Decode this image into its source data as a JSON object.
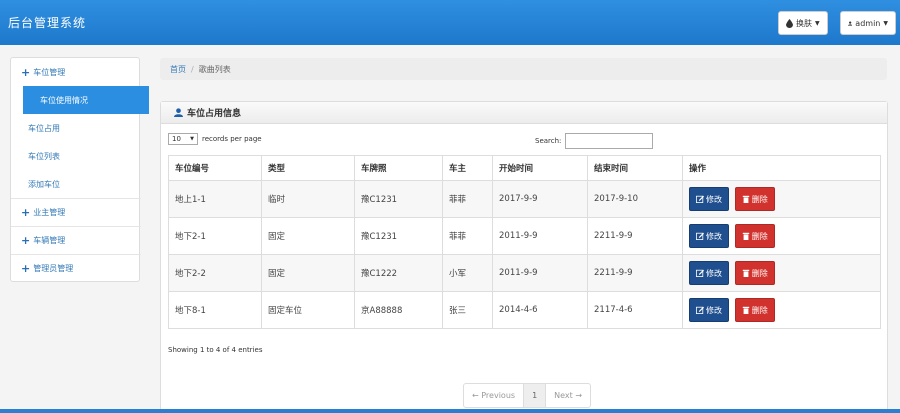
{
  "header": {
    "brand": "后台管理系统",
    "skin_button": "换肤",
    "user_button": "admin"
  },
  "sidebar": {
    "groups": [
      {
        "label": "车位管理",
        "items": [
          "车位使用情况",
          "车位占用",
          "车位列表",
          "添加车位"
        ]
      },
      {
        "label": "业主管理"
      },
      {
        "label": "车辆管理"
      },
      {
        "label": "管理员管理"
      }
    ]
  },
  "breadcrumb": {
    "home": "首页",
    "separator": "/",
    "current": "歌曲列表"
  },
  "panel": {
    "title": "车位占用信息",
    "length_value": "10",
    "length_label": "records per page",
    "search_label": "Search:",
    "search_value": "",
    "columns": [
      "车位编号",
      "类型",
      "车牌照",
      "车主",
      "开始时间",
      "结束时间",
      "操作"
    ],
    "rows": [
      [
        "地上1-1",
        "临时",
        "豫C1231",
        "菲菲",
        "2017-9-9",
        "2017-9-10"
      ],
      [
        "地下2-1",
        "固定",
        "豫C1231",
        "菲菲",
        "2011-9-9",
        "2211-9-9"
      ],
      [
        "地下2-2",
        "固定",
        "豫C1222",
        "小军",
        "2011-9-9",
        "2211-9-9"
      ],
      [
        "地下8-1",
        "固定车位",
        "京A88888",
        "张三",
        "2014-4-6",
        "2117-4-6"
      ]
    ],
    "edit_label": "修改",
    "delete_label": "删除",
    "info": "Showing 1 to 4 of 4 entries",
    "pager": {
      "prev": "← Previous",
      "page": "1",
      "next": "Next →"
    }
  },
  "colors": {
    "topbar": "#1e78cc",
    "sidebar_active": "#2b8ee0",
    "edit_button": "#1f4f8e",
    "delete_button": "#d2322d"
  }
}
